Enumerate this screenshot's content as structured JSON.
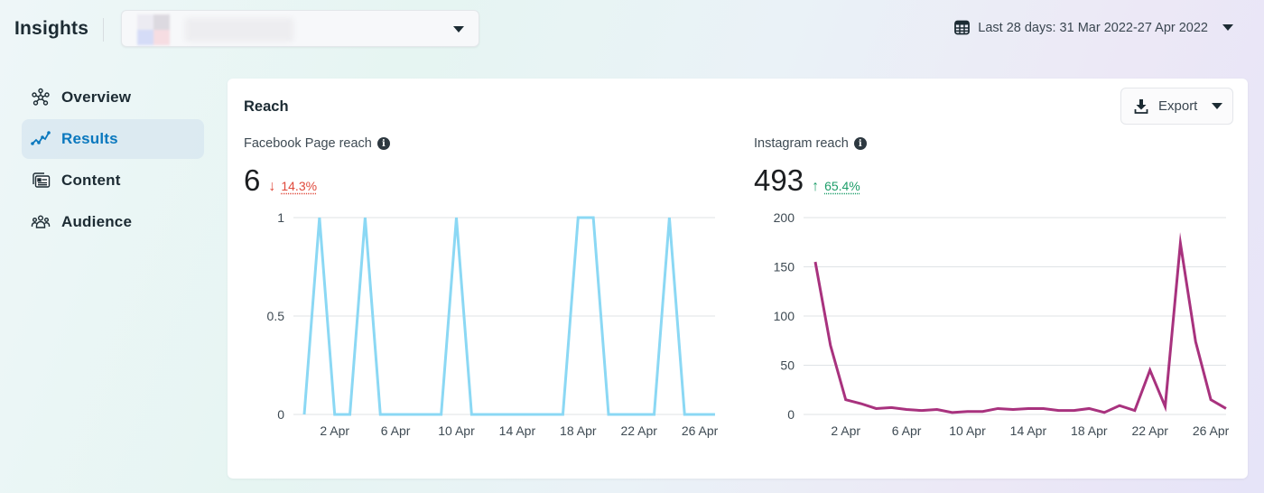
{
  "header": {
    "title": "Insights",
    "page_selector": {
      "value_redacted": true,
      "avatar_colors": [
        "#ecebf2",
        "#dcd9e0",
        "#d5dcf7",
        "#f6dde2"
      ]
    },
    "date_range": {
      "icon": "calendar-icon",
      "label": "Last 28 days: 31 Mar 2022-27 Apr 2022"
    }
  },
  "sidebar": {
    "items": [
      {
        "label": "Overview",
        "icon": "overview-network-icon",
        "active": false
      },
      {
        "label": "Results",
        "icon": "results-trend-icon",
        "active": true
      },
      {
        "label": "Content",
        "icon": "content-cards-icon",
        "active": false
      },
      {
        "label": "Audience",
        "icon": "audience-people-icon",
        "active": false
      }
    ]
  },
  "card": {
    "title": "Reach",
    "export": {
      "label": "Export",
      "icon": "download-icon"
    },
    "metrics": [
      {
        "label": "Facebook Page reach",
        "value": "6",
        "direction": "down",
        "arrow": "↓",
        "delta": "14.3%"
      },
      {
        "label": "Instagram reach",
        "value": "493",
        "direction": "up",
        "arrow": "↑",
        "delta": "65.4%"
      }
    ]
  },
  "colors": {
    "facebook_line": "#8bd8f4",
    "instagram_line": "#a8327e",
    "active_nav": "#0a78be",
    "delta_down": "#e0493b",
    "delta_up": "#1e9e6a"
  },
  "chart_data": [
    {
      "type": "line",
      "title": "Facebook Page reach",
      "xlabel": "",
      "ylabel": "",
      "x": [
        "31 Mar",
        "1 Apr",
        "2 Apr",
        "3 Apr",
        "4 Apr",
        "5 Apr",
        "6 Apr",
        "7 Apr",
        "8 Apr",
        "9 Apr",
        "10 Apr",
        "11 Apr",
        "12 Apr",
        "13 Apr",
        "14 Apr",
        "15 Apr",
        "16 Apr",
        "17 Apr",
        "18 Apr",
        "19 Apr",
        "20 Apr",
        "21 Apr",
        "22 Apr",
        "23 Apr",
        "24 Apr",
        "25 Apr",
        "26 Apr",
        "27 Apr"
      ],
      "series": [
        {
          "name": "Facebook Page reach",
          "values": [
            0,
            1,
            0,
            0,
            1,
            0,
            0,
            0,
            0,
            0,
            1,
            0,
            0,
            0,
            0,
            0,
            0,
            0,
            1,
            1,
            0,
            0,
            0,
            0,
            1,
            0,
            0,
            0
          ]
        }
      ],
      "xticks": [
        "2 Apr",
        "6 Apr",
        "10 Apr",
        "14 Apr",
        "18 Apr",
        "22 Apr",
        "26 Apr"
      ],
      "yticks": [
        "0",
        "0.5",
        "1"
      ],
      "ylim": [
        0,
        1
      ],
      "grid": true,
      "legend": "none"
    },
    {
      "type": "line",
      "title": "Instagram reach",
      "xlabel": "",
      "ylabel": "",
      "x": [
        "31 Mar",
        "1 Apr",
        "2 Apr",
        "3 Apr",
        "4 Apr",
        "5 Apr",
        "6 Apr",
        "7 Apr",
        "8 Apr",
        "9 Apr",
        "10 Apr",
        "11 Apr",
        "12 Apr",
        "13 Apr",
        "14 Apr",
        "15 Apr",
        "16 Apr",
        "17 Apr",
        "18 Apr",
        "19 Apr",
        "20 Apr",
        "21 Apr",
        "22 Apr",
        "23 Apr",
        "24 Apr",
        "25 Apr",
        "26 Apr",
        "27 Apr"
      ],
      "series": [
        {
          "name": "Instagram reach",
          "values": [
            155,
            70,
            15,
            11,
            6,
            7,
            5,
            4,
            5,
            2,
            3,
            3,
            6,
            5,
            6,
            6,
            4,
            4,
            6,
            2,
            9,
            4,
            45,
            8,
            174,
            74,
            15,
            6
          ]
        }
      ],
      "xticks": [
        "2 Apr",
        "6 Apr",
        "10 Apr",
        "14 Apr",
        "18 Apr",
        "22 Apr",
        "26 Apr"
      ],
      "yticks": [
        "0",
        "50",
        "100",
        "150",
        "200"
      ],
      "ylim": [
        0,
        200
      ],
      "grid": true,
      "legend": "none"
    }
  ]
}
